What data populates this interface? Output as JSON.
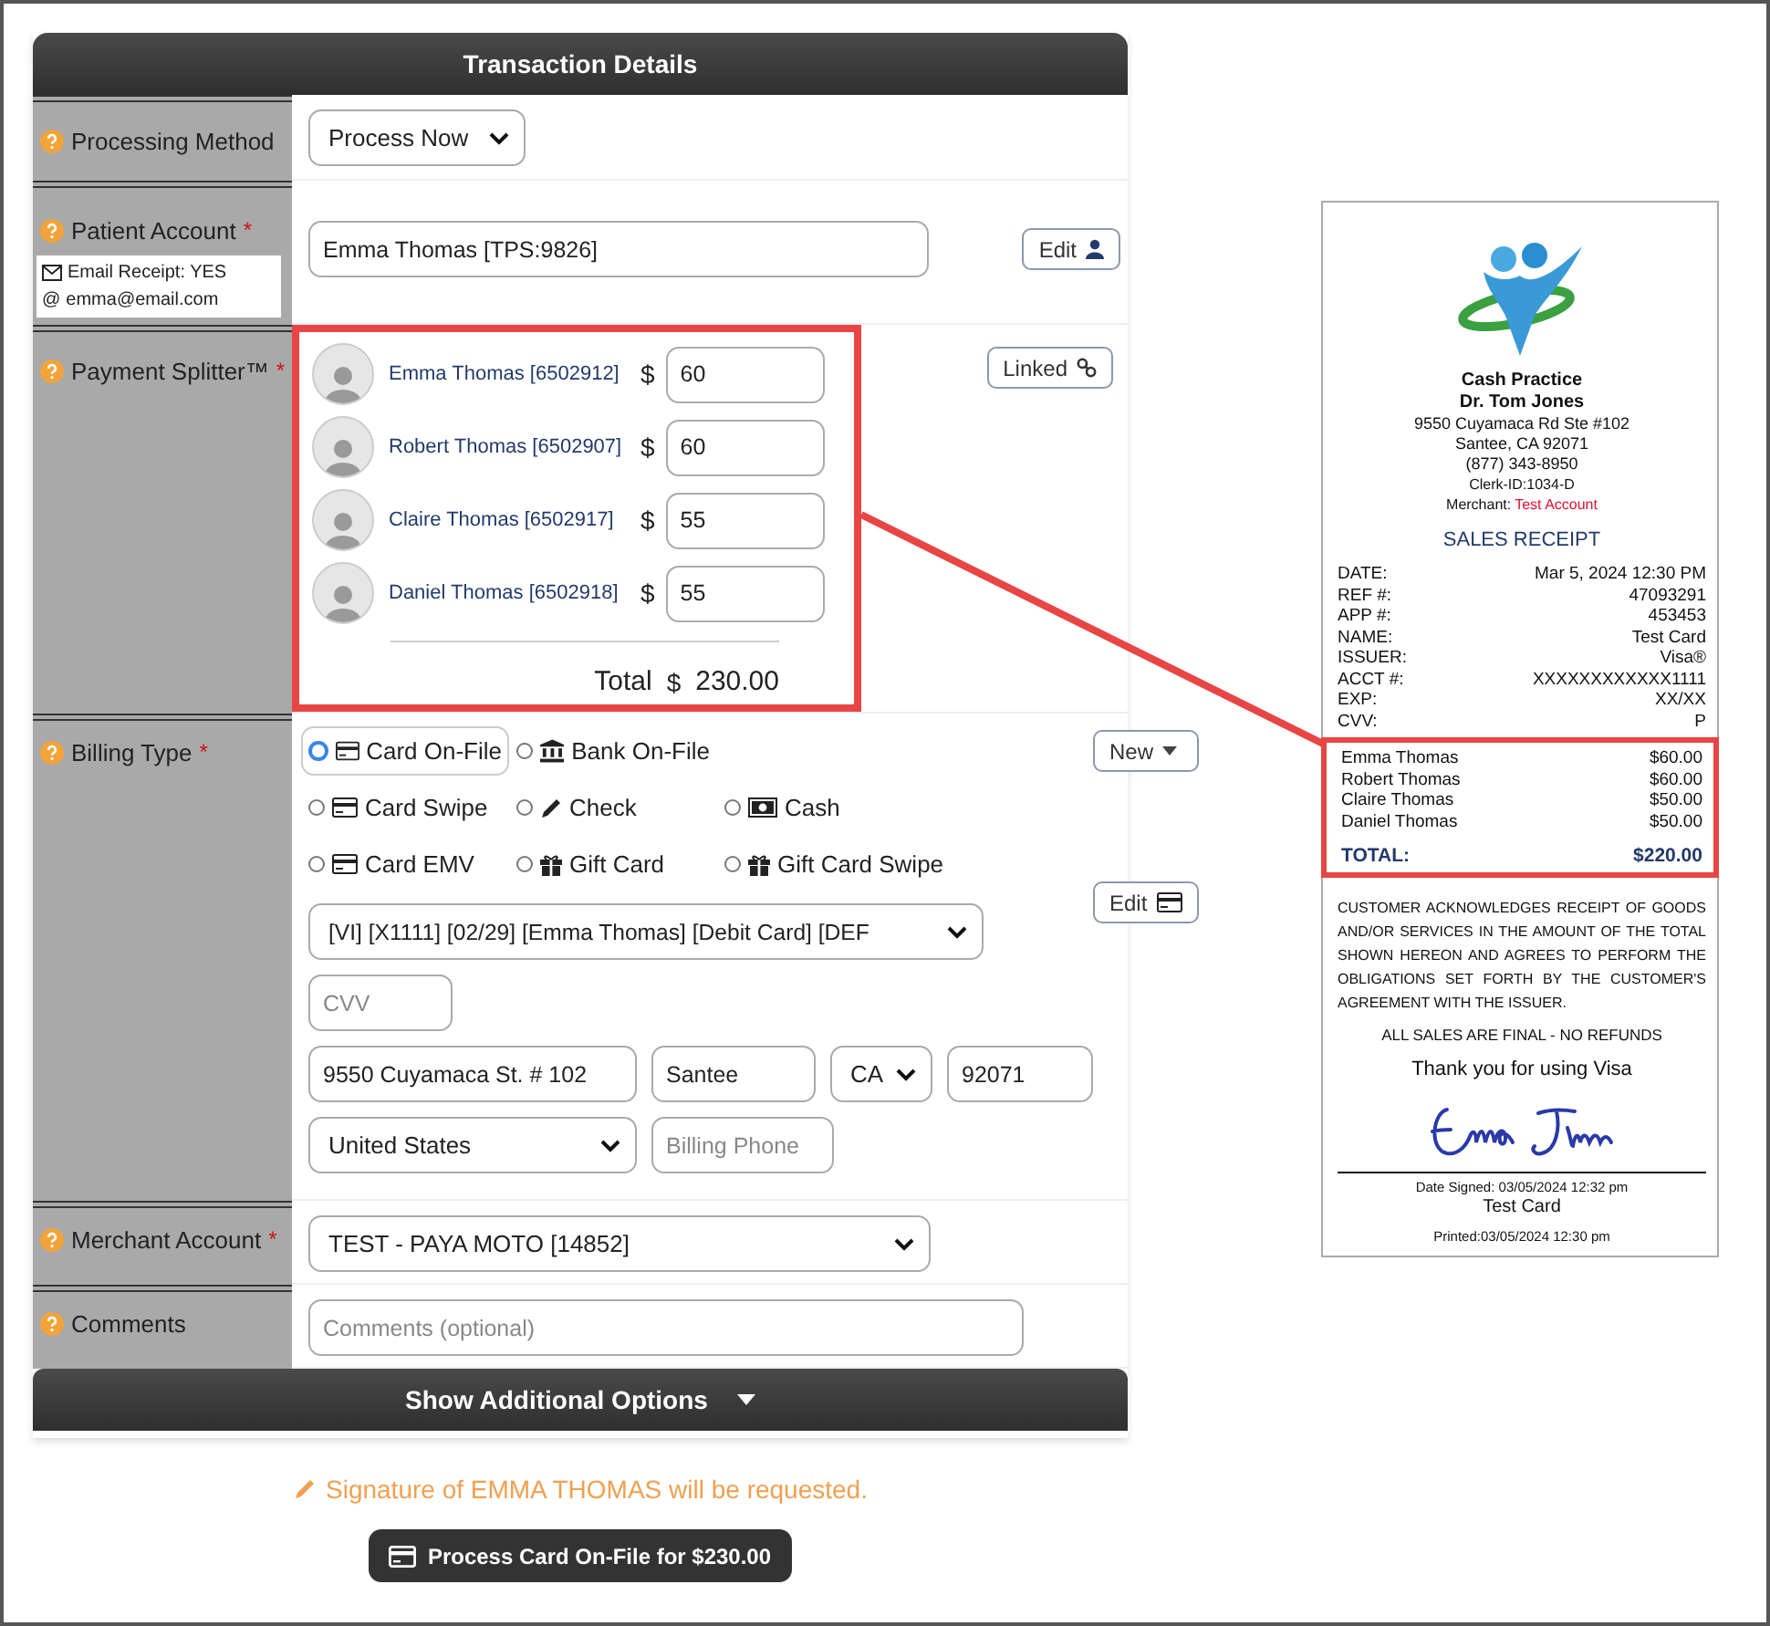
{
  "panel": {
    "title": "Transaction Details",
    "footer_toggle": "Show Additional Options"
  },
  "fields": [
    {
      "kind": "processing",
      "label": "Processing Method",
      "select": "Process Now"
    },
    {
      "kind": "patient",
      "label": "Patient Account",
      "required_mark": "*",
      "email_receipt": "Email Receipt: YES",
      "email_symbol": "@",
      "email": "emma@email.com",
      "value": "Emma Thomas [TPS:9826]",
      "button": "Edit"
    },
    {
      "kind": "splitter",
      "label": "Payment Splitter™",
      "required_mark": "*",
      "button": "Linked",
      "members": [
        {
          "name": "Emma Thomas [6502912]",
          "currency": "$",
          "amount": "60"
        },
        {
          "name": "Robert Thomas [6502907]",
          "currency": "$",
          "amount": "60"
        },
        {
          "name": "Claire Thomas [6502917]",
          "currency": "$",
          "amount": "55"
        },
        {
          "name": "Daniel Thomas [6502918]",
          "currency": "$",
          "amount": "55"
        }
      ],
      "total_label": "Total",
      "total_currency": "$",
      "total": "230.00"
    },
    {
      "kind": "billing",
      "label": "Billing Type",
      "required_mark": "*",
      "button": "New",
      "options": [
        {
          "label": "Card On-File",
          "kind": "card",
          "selected": true
        },
        {
          "label": "Bank On-File",
          "kind": "bank",
          "selected": false
        },
        {
          "label": "Card Swipe",
          "kind": "card",
          "selected": false
        },
        {
          "label": "Check",
          "kind": "check",
          "selected": false
        },
        {
          "label": "Cash",
          "kind": "cash",
          "selected": false
        },
        {
          "label": "Card EMV",
          "kind": "card",
          "selected": false
        },
        {
          "label": "Gift Card",
          "kind": "gift",
          "selected": false
        },
        {
          "label": "Gift Card Swipe",
          "kind": "gift",
          "selected": false
        }
      ],
      "card_select": "[VI] [X1111] [02/29] [Emma Thomas] [Debit Card] [DEF",
      "card_button": "Edit",
      "cvv_placeholder": "CVV",
      "address": "9550 Cuyamaca St. # 102",
      "city": "Santee",
      "state": "CA",
      "zip": "92071",
      "country": "United States",
      "phone_placeholder": "Billing Phone"
    },
    {
      "kind": "merchant",
      "label": "Merchant Account",
      "required_mark": "*",
      "select": "TEST - PAYA MOTO [14852]"
    },
    {
      "kind": "comments",
      "label": "Comments",
      "placeholder": "Comments (optional)"
    }
  ],
  "signature_notice": "Signature of EMMA THOMAS will be requested.",
  "submit_button": "Process Card On-File for $230.00",
  "receipt": {
    "business": [
      "Cash Practice",
      "Dr. Tom Jones"
    ],
    "address_lines": [
      "9550 Cuyamaca Rd Ste #102",
      "Santee, CA 92071",
      "(877) 343-8950",
      "Clerk-ID:1034-D"
    ],
    "merchant_label": "Merchant:",
    "merchant_value": "Test Account",
    "title": "SALES RECEIPT",
    "details": [
      {
        "label": "DATE:",
        "value": "Mar 5, 2024 12:30 PM"
      },
      {
        "label": "REF #:",
        "value": "47093291"
      },
      {
        "label": "APP #:",
        "value": "453453"
      },
      {
        "label": "NAME:",
        "value": "Test Card"
      },
      {
        "label": "ISSUER:",
        "value": "Visa®"
      },
      {
        "label": "ACCT #:",
        "value": "XXXXXXXXXXXX1111"
      },
      {
        "label": "EXP:",
        "value": "XX/XX"
      },
      {
        "label": "CVV:",
        "value": "P"
      }
    ],
    "splits": [
      {
        "name": "Emma Thomas",
        "amount": "$60.00"
      },
      {
        "name": "Robert Thomas",
        "amount": "$60.00"
      },
      {
        "name": "Claire Thomas",
        "amount": "$50.00"
      },
      {
        "name": "Daniel Thomas",
        "amount": "$50.00"
      }
    ],
    "total_label": "TOTAL:",
    "total": "$220.00",
    "disclaimer": "CUSTOMER ACKNOWLEDGES RECEIPT OF GOODS AND/OR SERVICES IN THE AMOUNT OF THE TOTAL SHOWN HEREON AND AGREES TO PERFORM THE OBLIGATIONS SET FORTH BY THE CUSTOMER'S AGREEMENT WITH THE ISSUER.",
    "final_notice": "ALL SALES ARE FINAL - NO REFUNDS",
    "thanks": "Thank you for using Visa",
    "date_signed": "Date Signed: 03/05/2024 12:32 pm",
    "signer": "Test Card",
    "printed": "Printed:03/05/2024 12:30 pm"
  }
}
